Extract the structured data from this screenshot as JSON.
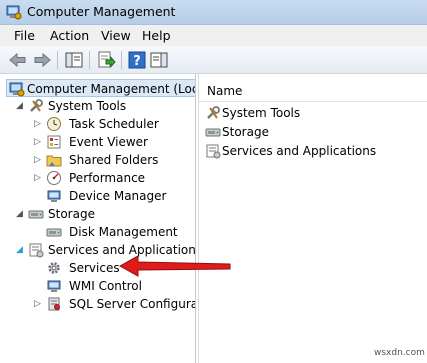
{
  "window": {
    "title": "Computer Management"
  },
  "menu": [
    "File",
    "Action",
    "View",
    "Help"
  ],
  "tree": [
    {
      "label": "Computer Management (Local",
      "level": 0,
      "icon": "computer-icon",
      "expander": ""
    },
    {
      "label": "System Tools",
      "level": 1,
      "icon": "tools-icon",
      "expander": "expanded"
    },
    {
      "label": "Task Scheduler",
      "level": 2,
      "icon": "clock-icon",
      "expander": "collapsed"
    },
    {
      "label": "Event Viewer",
      "level": 2,
      "icon": "event-viewer-icon",
      "expander": "collapsed"
    },
    {
      "label": "Shared Folders",
      "level": 2,
      "icon": "shared-folder-icon",
      "expander": "collapsed"
    },
    {
      "label": "Performance",
      "level": 2,
      "icon": "performance-icon",
      "expander": "collapsed"
    },
    {
      "label": "Device Manager",
      "level": 2,
      "icon": "device-manager-icon",
      "expander": ""
    },
    {
      "label": "Storage",
      "level": 1,
      "icon": "storage-icon",
      "expander": "expanded"
    },
    {
      "label": "Disk Management",
      "level": 2,
      "icon": "disk-icon",
      "expander": ""
    },
    {
      "label": "Services and Applications",
      "level": 1,
      "icon": "services-apps-icon",
      "expander": "expanded-open"
    },
    {
      "label": "Services",
      "level": 2,
      "icon": "gear-icon",
      "expander": ""
    },
    {
      "label": "WMI Control",
      "level": 2,
      "icon": "wmi-icon",
      "expander": ""
    },
    {
      "label": "SQL Server Configuratic",
      "level": 2,
      "icon": "sql-server-icon",
      "expander": "collapsed"
    }
  ],
  "list": {
    "column_header": "Name",
    "items": [
      {
        "label": "System Tools",
        "icon": "tools-icon"
      },
      {
        "label": "Storage",
        "icon": "storage-icon"
      },
      {
        "label": "Services and Applications",
        "icon": "services-apps-icon"
      }
    ]
  },
  "annotation": {
    "arrow_color": "#e11b1b"
  },
  "watermark": "wsxdn.com"
}
